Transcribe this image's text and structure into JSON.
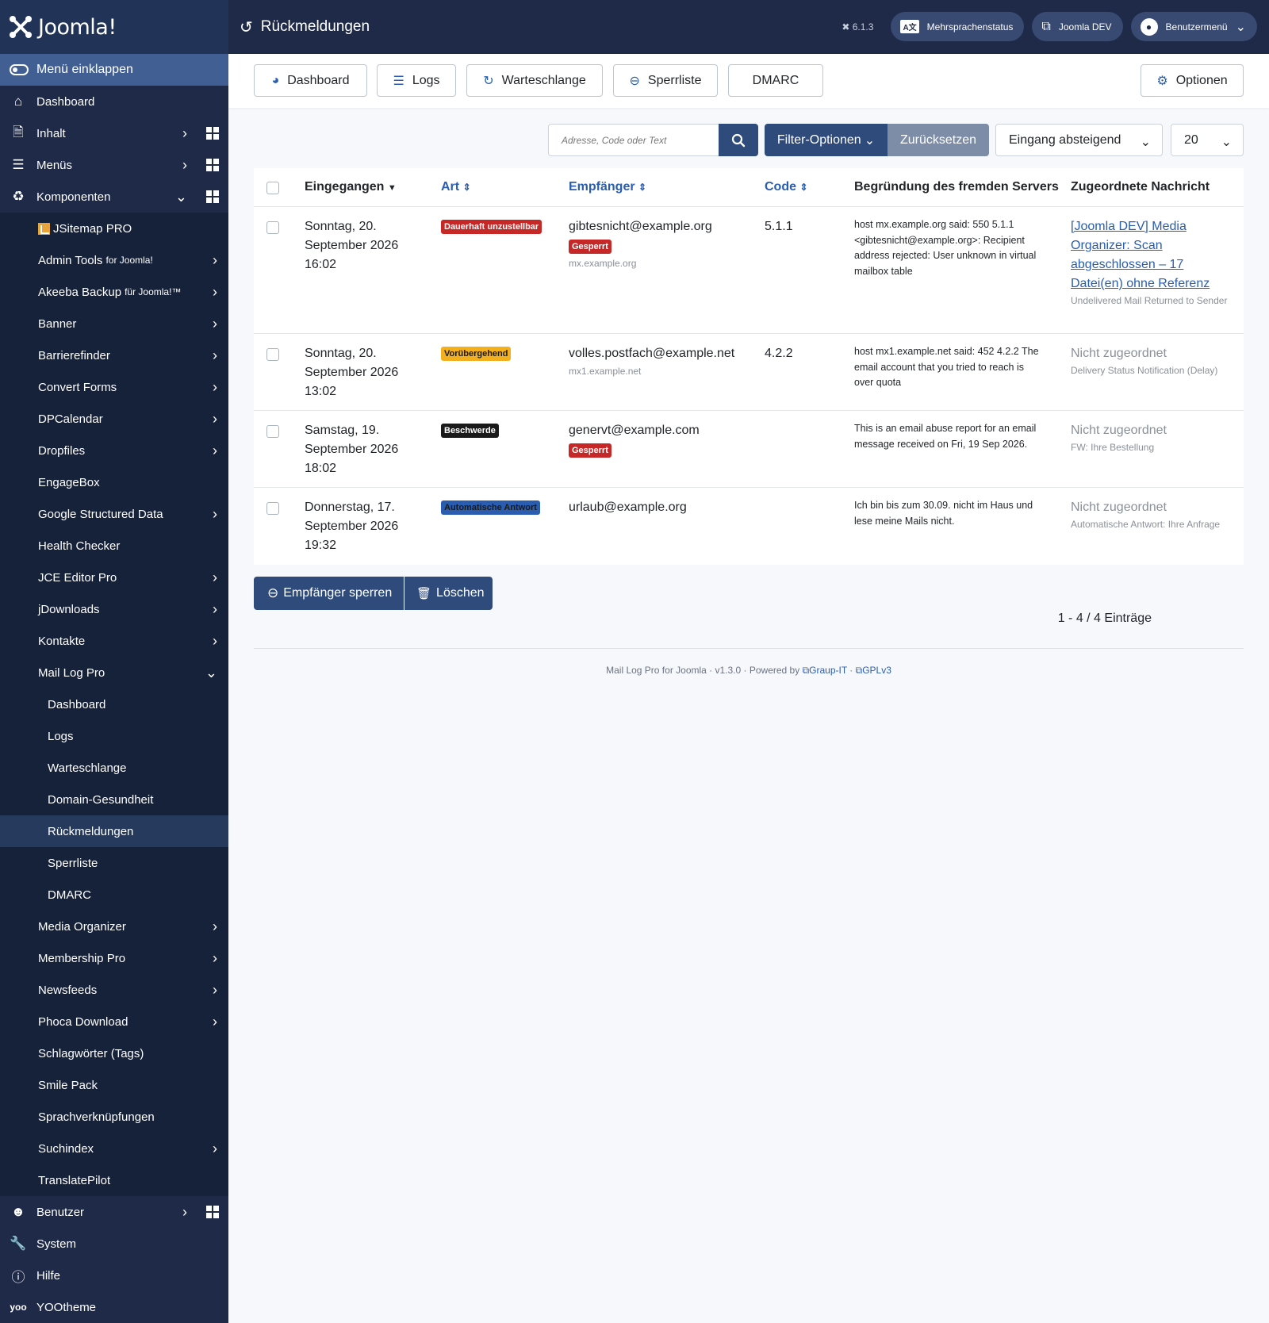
{
  "brand": {
    "name": "Joomla!"
  },
  "header": {
    "title": "Rückmeldungen",
    "version": "6.1.3",
    "buttons": [
      {
        "label": "Mehrsprachenstatus"
      },
      {
        "label": "Joomla DEV"
      },
      {
        "label": "Benutzermenü"
      }
    ]
  },
  "sidebar": {
    "collapse_label": "Menü einklappen",
    "items": [
      {
        "label": "Dashboard"
      },
      {
        "label": "Inhalt"
      },
      {
        "label": "Menüs"
      },
      {
        "label": "Komponenten"
      },
      {
        "label": "JSitemap PRO"
      },
      {
        "label": "Admin Tools",
        "suffix": "for Joomla!"
      },
      {
        "label": "Akeeba Backup",
        "suffix": "für Joomla!™"
      },
      {
        "label": "Banner"
      },
      {
        "label": "Barrierefinder"
      },
      {
        "label": "Convert Forms"
      },
      {
        "label": "DPCalendar"
      },
      {
        "label": "Dropfiles"
      },
      {
        "label": "EngageBox"
      },
      {
        "label": "Google Structured Data"
      },
      {
        "label": "Health Checker"
      },
      {
        "label": "JCE Editor Pro"
      },
      {
        "label": "jDownloads"
      },
      {
        "label": "Kontakte"
      },
      {
        "label": "Mail Log Pro"
      },
      {
        "label": "Dashboard"
      },
      {
        "label": "Logs"
      },
      {
        "label": "Warteschlange"
      },
      {
        "label": "Domain-Gesundheit"
      },
      {
        "label": "Rückmeldungen"
      },
      {
        "label": "Sperrliste"
      },
      {
        "label": "DMARC"
      },
      {
        "label": "Media Organizer"
      },
      {
        "label": "Membership Pro"
      },
      {
        "label": "Newsfeeds"
      },
      {
        "label": "Phoca Download"
      },
      {
        "label": "Schlagwörter (Tags)"
      },
      {
        "label": "Smile Pack"
      },
      {
        "label": "Sprachverknüpfungen"
      },
      {
        "label": "Suchindex"
      },
      {
        "label": "TranslatePilot"
      },
      {
        "label": "Benutzer"
      },
      {
        "label": "System"
      },
      {
        "label": "Hilfe"
      },
      {
        "label": "YOOtheme"
      }
    ]
  },
  "toolbar": {
    "buttons": [
      {
        "label": "Dashboard"
      },
      {
        "label": "Logs"
      },
      {
        "label": "Warteschlange"
      },
      {
        "label": "Sperrliste"
      },
      {
        "label": "DMARC"
      }
    ],
    "options_label": "Optionen"
  },
  "filters": {
    "search_placeholder": "Adresse, Code oder Text",
    "filter_label": "Filter-Optionen",
    "reset_label": "Zurücksetzen",
    "sort_value": "Eingang absteigend",
    "limit_value": "20"
  },
  "table": {
    "headers": {
      "received": "Eingegangen",
      "type": "Art",
      "recipient": "Empfänger",
      "code": "Code",
      "reason": "Begründung des fremden Servers",
      "message": "Zugeordnete Nachricht"
    },
    "rows": [
      {
        "date": "Sonntag, 20. September 2026 16:02",
        "type": "Dauerhaft unzustellbar",
        "recipient": "gibtesnicht@example.org",
        "blocked": "Gesperrt",
        "host": "mx.example.org",
        "code": "5.1.1",
        "reason": "host mx.example.org said: 550 5.1.1 <gibtesnicht@example.org>: Recipient address rejected: User unknown in virtual mailbox table",
        "message_link": "[Joomla DEV] Media Organizer: Scan abgeschlossen – 17 Datei(en) ohne Referenz",
        "message_sub": "Undelivered Mail Returned to Sender"
      },
      {
        "date": "Sonntag, 20. September 2026 13:02",
        "type": "Vorübergehend",
        "recipient": "volles.postfach@example.net",
        "host": "mx1.example.net",
        "code": "4.2.2",
        "reason": "host mx1.example.net said: 452 4.2.2 The email account that you tried to reach is over quota",
        "message_status": "Nicht zugeordnet",
        "message_sub": "Delivery Status Notification (Delay)"
      },
      {
        "date": "Samstag, 19. September 2026 18:02",
        "type": "Beschwerde",
        "recipient": "genervt@example.com",
        "blocked": "Gesperrt",
        "reason": "This is an email abuse report for an email message received on Fri, 19 Sep 2026.",
        "message_status": "Nicht zugeordnet",
        "message_sub": "FW: Ihre Bestellung"
      },
      {
        "date": "Donnerstag, 17. September 2026 19:32",
        "type": "Automatische Antwort",
        "recipient": "urlaub@example.org",
        "reason": "Ich bin bis zum 30.09. nicht im Haus und lese meine Mails nicht.",
        "message_status": "Nicht zugeordnet",
        "message_sub": "Automatische Antwort: Ihre Anfrage"
      }
    ]
  },
  "actions": {
    "block_label": "Empfänger sperren",
    "delete_label": "Löschen"
  },
  "pagination": {
    "summary": "1 - 4 / 4 Einträge"
  },
  "footer": {
    "text": "Mail Log Pro for Joomla · v1.3.0 · Powered by",
    "link1": "Graup-IT",
    "sep": "·",
    "link2": "GPLv3"
  },
  "colors": {
    "sidebar": "#1e2a47",
    "accent": "#2f4b7c",
    "link": "#2a5db0",
    "danger": "#c52827",
    "warning": "#f2b01e"
  }
}
